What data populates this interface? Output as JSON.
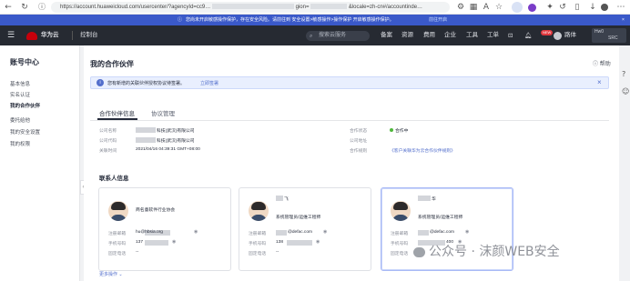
{
  "browser": {
    "url": "https://account.huaweicloud.com/usercenter/?agencyId=cc9…",
    "url_tail_locale": "&locale=zh-cn#/accountinde…",
    "url_mid": "gion=",
    "back_icon": "back-arrow-icon",
    "reload_icon": "reload-icon"
  },
  "notice": {
    "text": "您尚未开启敏感操作保护，存在安全风险。请前往到 安全设置>敏感操作>操作保护 开启敏感操作保护。",
    "link": "前往开启"
  },
  "topnav": {
    "brand": "华为云",
    "console": "控制台",
    "search_placeholder": "搜索云服务",
    "items": [
      "备案",
      "资源",
      "费用",
      "企业",
      "工具",
      "工单"
    ],
    "user": "路体",
    "badge": "NEW",
    "account_tag": "Hw0",
    "account_tag2": "SRC"
  },
  "sidebar": {
    "title": "账号中心",
    "items": [
      "基本信息",
      "实名认证",
      "我的合作伙伴",
      "委托给他",
      "我的安全设置",
      "我的权限"
    ]
  },
  "page": {
    "title": "我的合作伙伴",
    "help": "帮助",
    "info_text": "您有新增的关联伙伴授权协议待签署。",
    "info_link": "立即签署",
    "tabs": [
      "合作伙伴信息",
      "协议管理"
    ]
  },
  "partner": {
    "name_label": "公司名称",
    "name_value": "科技(武汉)有限公司",
    "code_label": "公司代码",
    "code_value": "科技(武汉)有限公司",
    "time_label": "关联时间",
    "time_value": "2021/04/16 04:39:31 GMT+08:00",
    "status_label": "合作状态",
    "status_value": "合作中",
    "region_label": "公司地址",
    "rules_label": "合作规则",
    "rules_link": "《客户关联华为云合作伙伴规则》"
  },
  "contacts": {
    "title": "联系人信息",
    "more": "更多操作",
    "email_label": "注册邮箱",
    "phone_label": "手机号码",
    "tel_label": "固定电话",
    "cards": [
      {
        "name": "商名童软件行业协会",
        "role": "",
        "email": "hu@hbsia.org",
        "phone": "137",
        "tel": "--"
      },
      {
        "name": "飞",
        "role": "系统管理员/运维工程师",
        "email": "@defac.com",
        "phone": "138",
        "tel": "--"
      },
      {
        "name": "华",
        "role": "系统管理员/运维工程师",
        "email": "@defac.com",
        "phone": "400",
        "tel": "--"
      }
    ]
  },
  "watermark": "公众号 · 沫颜WEB安全",
  "colors": {
    "accent": "#3a59c9",
    "nav_bg": "#262a32",
    "link": "#526ecc",
    "ok": "#50b83c"
  }
}
